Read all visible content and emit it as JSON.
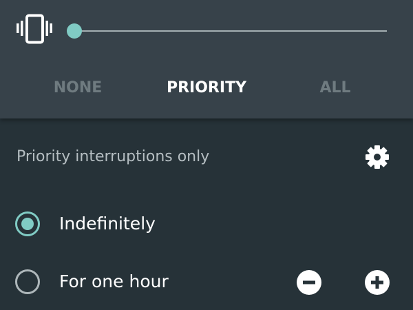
{
  "header": {
    "mode_tabs": [
      {
        "label": "NONE",
        "active": false
      },
      {
        "label": "PRIORITY",
        "active": true
      },
      {
        "label": "ALL",
        "active": false
      }
    ],
    "volume_level": 0
  },
  "section": {
    "title": "Priority interruptions only"
  },
  "options": [
    {
      "label": "Indefinitely",
      "selected": true
    },
    {
      "label": "For one hour",
      "selected": false
    }
  ],
  "colors": {
    "accent": "#80cbc4",
    "panel_top": "#37424a",
    "background": "#263238",
    "inactive_tab": "#6f7b80"
  },
  "icons": {
    "ringer": "vibrate-icon",
    "settings": "gear-icon",
    "decrease": "minus-circle-icon",
    "increase": "plus-circle-icon"
  }
}
